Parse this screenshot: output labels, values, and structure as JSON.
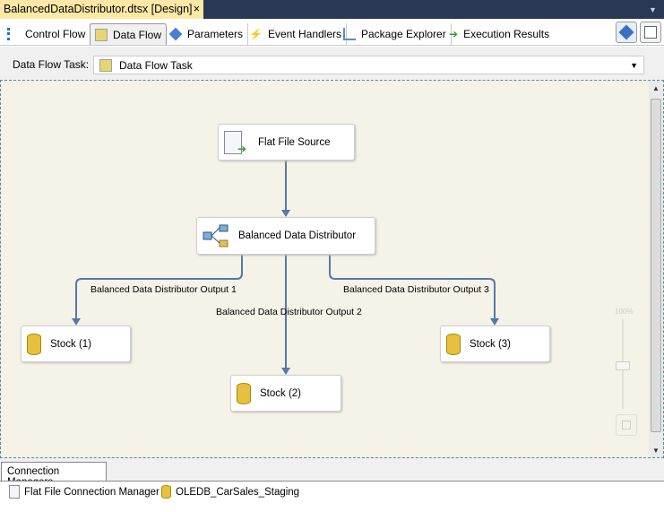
{
  "document_tab": {
    "title": "BalancedDataDistributor.dtsx [Design]",
    "close": "×"
  },
  "tabs": [
    {
      "label": "Control Flow",
      "icon": "control-flow-icon"
    },
    {
      "label": "Data Flow",
      "icon": "data-flow-icon",
      "active": true
    },
    {
      "label": "Parameters",
      "icon": "parameters-icon"
    },
    {
      "label": "Event Handlers",
      "icon": "lightning-icon"
    },
    {
      "label": "Package Explorer",
      "icon": "tree-icon"
    },
    {
      "label": "Execution Results",
      "icon": "green-arrow-icon"
    }
  ],
  "task": {
    "label": "Data Flow Task:",
    "value": "Data Flow Task"
  },
  "nodes": {
    "source": "Flat File Source",
    "distributor": "Balanced Data Distributor",
    "stock1": "Stock (1)",
    "stock2": "Stock (2)",
    "stock3": "Stock (3)"
  },
  "paths": {
    "out1": "Balanced Data Distributor Output 1",
    "out2": "Balanced Data Distributor Output 2",
    "out3": "Balanced Data Distributor Output 3"
  },
  "zoom": {
    "label": "100%",
    "level_percent": 100
  },
  "connection_managers": {
    "tab": "Connection Managers",
    "items": [
      "Flat File Connection Manager",
      "OLEDB_CarSales_Staging"
    ]
  },
  "colors": {
    "title_bar": "#293955",
    "doc_tab": "#fbe9a5",
    "canvas": "#f5f2e7",
    "connector": "#5878a8"
  }
}
